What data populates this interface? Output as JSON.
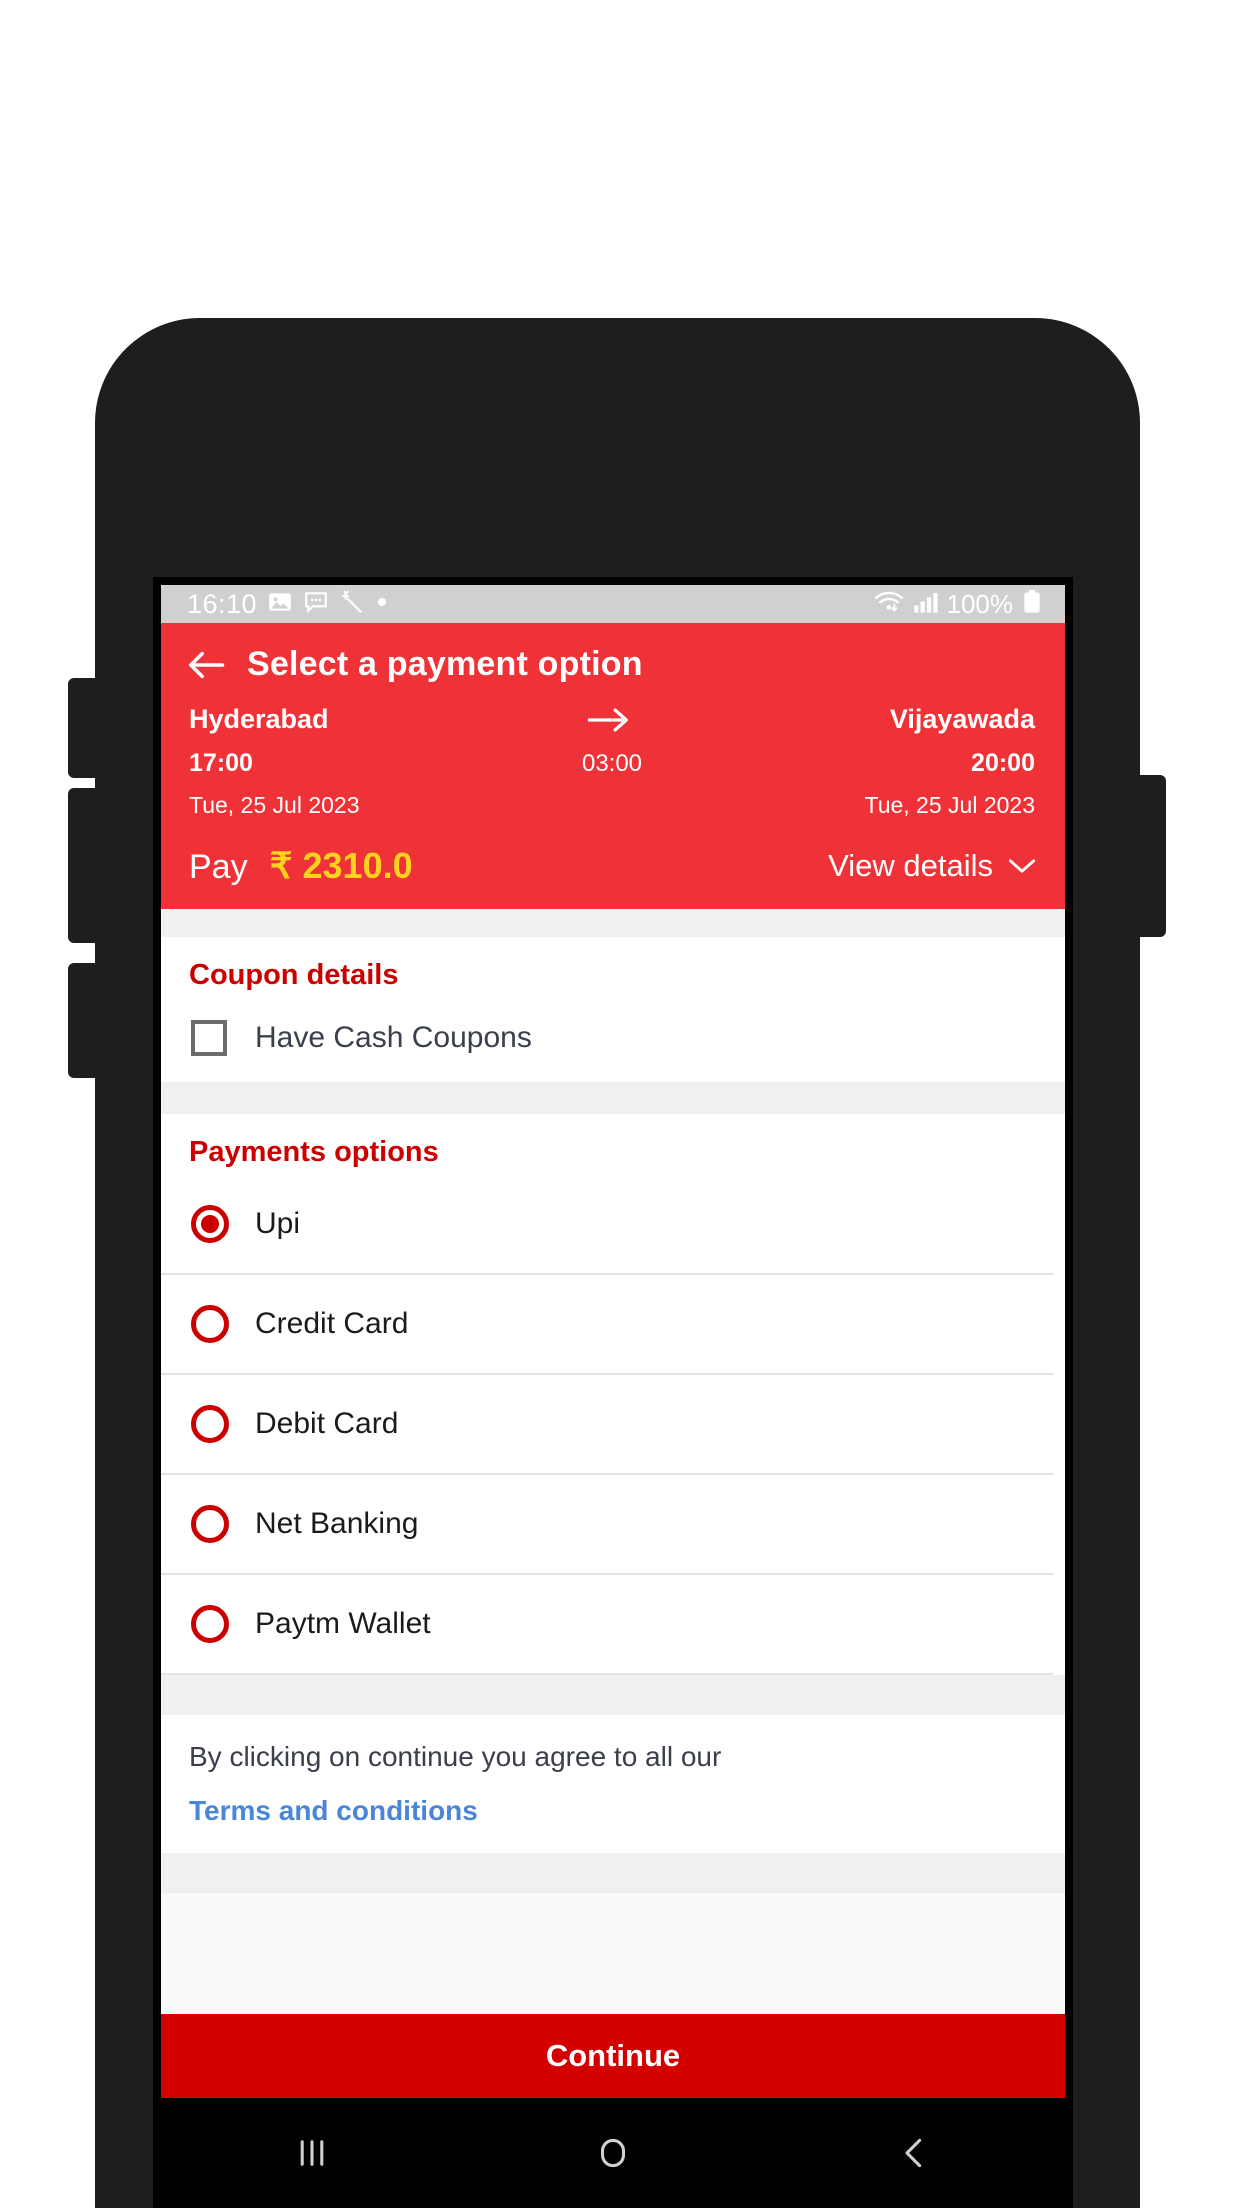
{
  "status_bar": {
    "clock": "16:10",
    "battery_text": "100%",
    "left_icons": [
      "image-icon",
      "chat-bubble-icon",
      "magic-wand-icon",
      "dot-icon"
    ],
    "right_icons": [
      "wifi-icon",
      "cellular-signal-icon",
      "battery-icon"
    ]
  },
  "header": {
    "back_icon": "back-arrow-icon",
    "title": "Select a payment option",
    "accent_color": "#ef3237",
    "journey": {
      "from_city": "Hyderabad",
      "to_city": "Vijayawada",
      "arrow_icon": "arrow-right-icon",
      "depart_time": "17:00",
      "duration": "03:00",
      "arrive_time": "20:00",
      "depart_date": "Tue, 25 Jul 2023",
      "arrive_date": "Tue, 25 Jul 2023"
    },
    "pay_label": "Pay",
    "pay_amount": "₹ 2310.0",
    "pay_amount_color": "#ffd21e",
    "view_details_label": "View details",
    "view_details_icon": "chevron-down-icon"
  },
  "coupon": {
    "title": "Coupon details",
    "checkbox_label": "Have Cash Coupons",
    "checked": false
  },
  "payments": {
    "title": "Payments options",
    "options": [
      {
        "label": "Upi",
        "selected": true
      },
      {
        "label": "Credit Card",
        "selected": false
      },
      {
        "label": "Debit Card",
        "selected": false
      },
      {
        "label": "Net Banking",
        "selected": false
      },
      {
        "label": "Paytm Wallet",
        "selected": false
      }
    ]
  },
  "terms": {
    "text": "By clicking on continue you agree to all our",
    "link": "Terms and conditions",
    "link_color": "#4a86d8"
  },
  "footer": {
    "continue_label": "Continue",
    "continue_color": "#d40000"
  },
  "nav_bar": {
    "recents_icon": "recents-icon",
    "home_icon": "home-icon",
    "back_icon": "back-chevron-icon"
  }
}
